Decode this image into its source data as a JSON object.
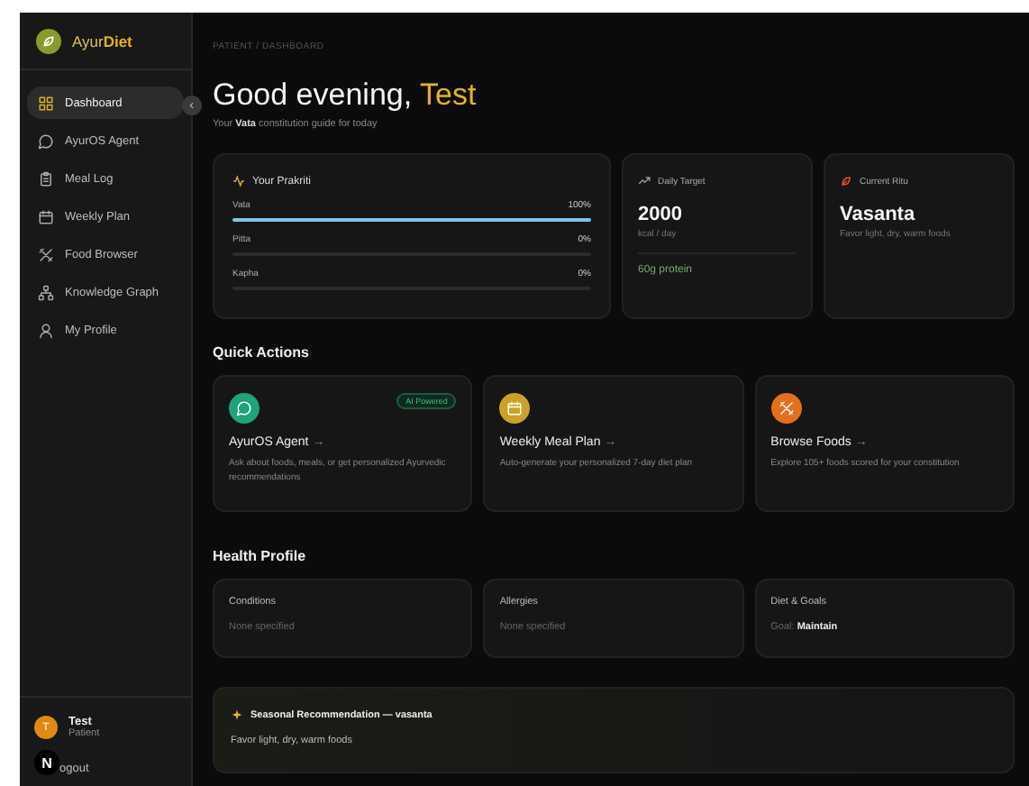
{
  "sidebar": {
    "logo": {
      "prefix": "Ayur",
      "accent": "Diet"
    },
    "items": [
      {
        "label": "Dashboard",
        "kind": "grid",
        "selected": true
      },
      {
        "label": "AyurOS Agent",
        "kind": "chat",
        "selected": false
      },
      {
        "label": "Meal Log",
        "kind": "clipboard",
        "selected": false
      },
      {
        "label": "Weekly Plan",
        "kind": "calendar",
        "selected": false
      },
      {
        "label": "Food Browser",
        "kind": "utensils",
        "selected": false
      },
      {
        "label": "Knowledge Graph",
        "kind": "network",
        "selected": false
      },
      {
        "label": "My Profile",
        "kind": "person",
        "selected": false
      }
    ],
    "user": {
      "initial": "T",
      "name": "Test",
      "role": "Patient"
    },
    "logout": "ogout",
    "dev_badge": "N"
  },
  "breadcrumb": "PATIENT / DASHBOARD",
  "greeting": "Good evening,",
  "user_name": "Test",
  "subtitle": "Your **Vata** constitution guide for today",
  "prakriti": {
    "title": "Your Prakriti",
    "doshas": [
      {
        "name": "Vata",
        "reading": "100%",
        "level": 1
      },
      {
        "name": "Pitta",
        "reading": "0%",
        "level": 0
      },
      {
        "name": "Kapha",
        "reading": "0%",
        "level": 0
      }
    ]
  },
  "daily_target": {
    "title": "Daily Target",
    "value": "2000",
    "unit": "kcal / day",
    "protein": "60g protein"
  },
  "current_ritu": {
    "title": "Current Ritu",
    "value": "Vasanta",
    "note": "Favor light, dry, warm foods"
  },
  "quick_actions": {
    "title": "Quick Actions",
    "items": [
      {
        "kind": "chat",
        "title": "AyurOS Agent",
        "arrow": "→",
        "description": "Ask about foods, meals, or get personalized Ayurvedic recommendations",
        "badge": "AI Powered",
        "color": "#1ea37a"
      },
      {
        "kind": "calendar",
        "title": "Weekly Meal Plan",
        "arrow": "→",
        "description": "Auto-generate your personalized 7-day diet plan",
        "color": "#c9a227"
      },
      {
        "kind": "utensils",
        "title": "Browse Foods",
        "arrow": "→",
        "description": "Explore 105+ foods scored for your constitution",
        "color": "#e3701c"
      }
    ]
  },
  "health_profile": {
    "title": "Health Profile",
    "cards": [
      {
        "kind": "plain",
        "title": "Conditions",
        "value": "None specified"
      },
      {
        "kind": "plain",
        "title": "Allergies",
        "value": "None specified"
      },
      {
        "kind": "goal",
        "title": "Diet & Goals",
        "label": "Goal:",
        "value": "Maintain"
      }
    ]
  },
  "seasonal": {
    "title": "Seasonal Recommendation — vasanta",
    "text": "Favor light, dry, warm foods"
  }
}
